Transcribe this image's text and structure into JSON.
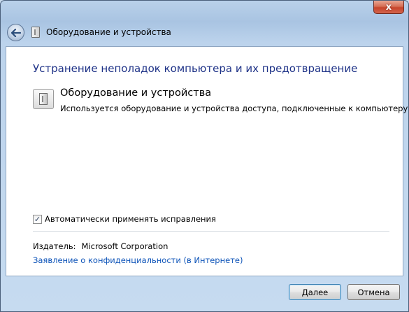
{
  "window": {
    "close_glyph": "x"
  },
  "navbar": {
    "title": "Оборудование и устройства",
    "back_icon": "back-arrow-icon",
    "app_icon": "hardware-device-icon"
  },
  "main": {
    "heading": "Устранение неполадок компьютера и их предотвращение",
    "item": {
      "title": "Оборудование и устройства",
      "description": "Используется оборудование и устройства доступа, подключенные к компьютеру.",
      "icon": "hardware-device-icon"
    },
    "auto_fix": {
      "label": "Автоматически применять исправления",
      "checked": true,
      "check_glyph": "✓"
    },
    "publisher": {
      "label": "Издатель:",
      "value": "Microsoft Corporation"
    },
    "privacy_link": "Заявление о конфиденциальности (в Интернете)"
  },
  "footer": {
    "next_label": "Далее",
    "cancel_label": "Отмена"
  },
  "colors": {
    "heading": "#1e3287",
    "link": "#0f55b9",
    "close_button": "#c7442b",
    "frame": "#b9d1ea"
  }
}
